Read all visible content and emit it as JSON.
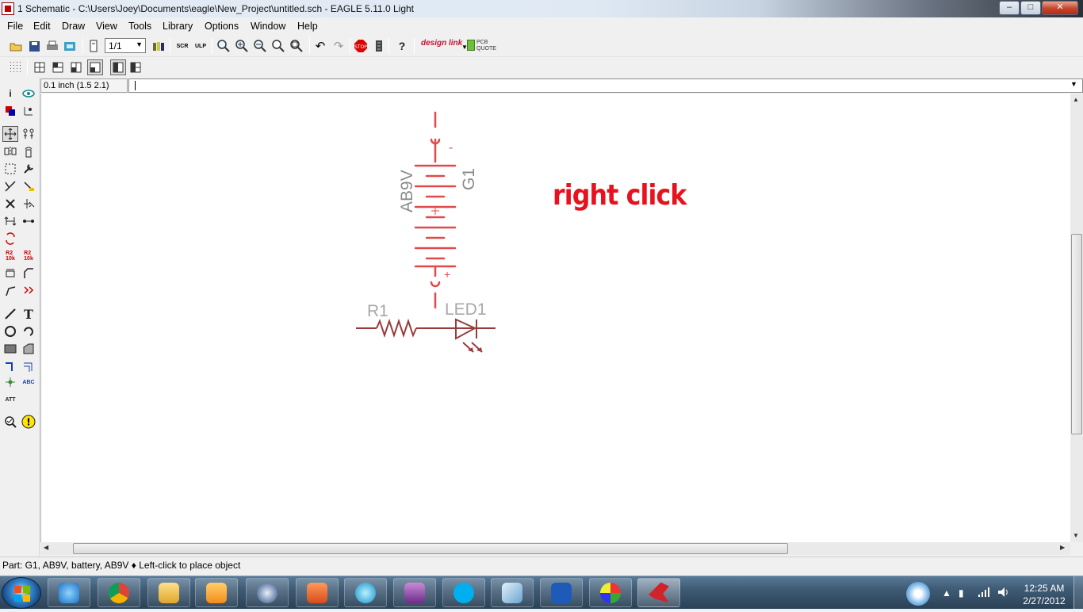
{
  "window": {
    "title": "1 Schematic - C:\\Users\\Joey\\Documents\\eagle\\New_Project\\untitled.sch - EAGLE 5.11.0 Light",
    "minimize": "–",
    "maximize": "□",
    "close": "✕"
  },
  "menu": {
    "items": [
      "File",
      "Edit",
      "Draw",
      "View",
      "Tools",
      "Library",
      "Options",
      "Window",
      "Help"
    ]
  },
  "toolbar": {
    "sheet_select": "1/1",
    "designlink_label": "design link",
    "pcb_quote_label": "PCB QUOTE"
  },
  "command": {
    "coordinates": "0.1 inch (1.5 2.1)",
    "input_value": ""
  },
  "schematic": {
    "battery": {
      "name": "G1",
      "value": "AB9V",
      "minus": "-",
      "plus": "+"
    },
    "resistor": {
      "name": "R1"
    },
    "led": {
      "name": "LED1"
    },
    "annotation": "right click",
    "colors": {
      "battery": "#e04a4a",
      "parts": "#9a3b3b",
      "labels": "#a8a8a8",
      "annotation": "#e8121e"
    }
  },
  "status": {
    "text": "Part: G1, AB9V, battery, AB9V  ♦ Left-click to place object"
  },
  "taskbar": {
    "apps": [
      "internet-explorer-icon",
      "chrome-icon",
      "file-explorer-icon",
      "media-player-icon",
      "hp-icon",
      "office-icon",
      "sphere-icon",
      "media-center-icon",
      "skype-icon",
      "outlook-icon",
      "word-icon",
      "paint-icon",
      "eagle-icon"
    ],
    "time": "12:25 AM",
    "date": "2/27/2012"
  }
}
